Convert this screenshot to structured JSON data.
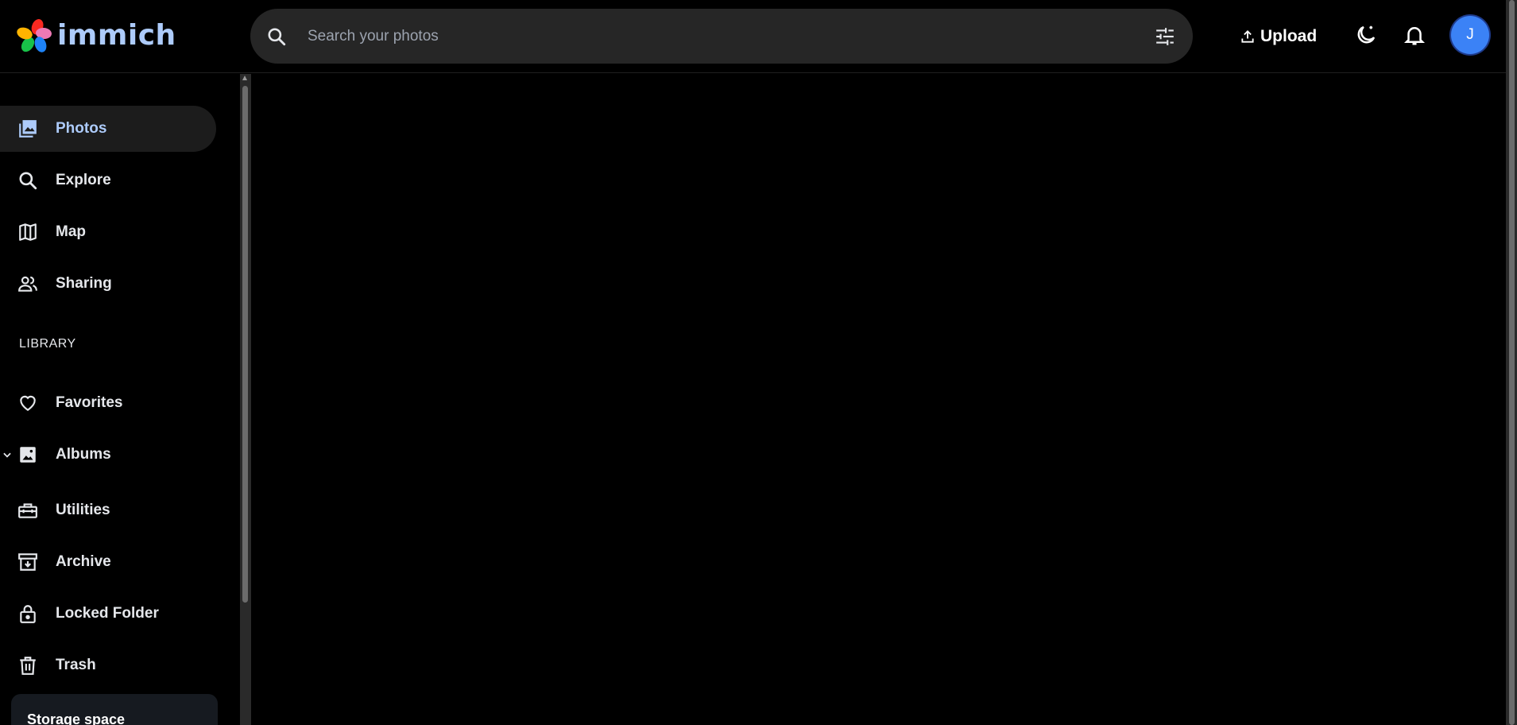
{
  "app": {
    "name": "immich",
    "brand_color": "#adcbfa",
    "background": "#000000"
  },
  "header": {
    "search": {
      "placeholder": "Search your photos",
      "value": "",
      "icon": "search-icon",
      "filter_icon": "tune-icon"
    },
    "upload_label": "Upload",
    "theme_icon": "theme-toggle-icon",
    "notifications_icon": "bell-icon",
    "avatar_initial": "J",
    "avatar_color": "#3b82f6"
  },
  "sidebar": {
    "items": [
      {
        "label": "Photos",
        "icon": "photos-icon",
        "active": true
      },
      {
        "label": "Explore",
        "icon": "search-icon"
      },
      {
        "label": "Map",
        "icon": "map-icon"
      },
      {
        "label": "Sharing",
        "icon": "people-icon"
      }
    ],
    "library_label": "LIBRARY",
    "library_items": [
      {
        "label": "Favorites",
        "icon": "heart-icon"
      },
      {
        "label": "Albums",
        "icon": "album-icon",
        "expandable": true
      },
      {
        "label": "Utilities",
        "icon": "toolbox-icon"
      },
      {
        "label": "Archive",
        "icon": "archive-icon"
      },
      {
        "label": "Locked Folder",
        "icon": "lock-icon"
      },
      {
        "label": "Trash",
        "icon": "trash-icon"
      }
    ],
    "storage_label": "Storage space"
  }
}
